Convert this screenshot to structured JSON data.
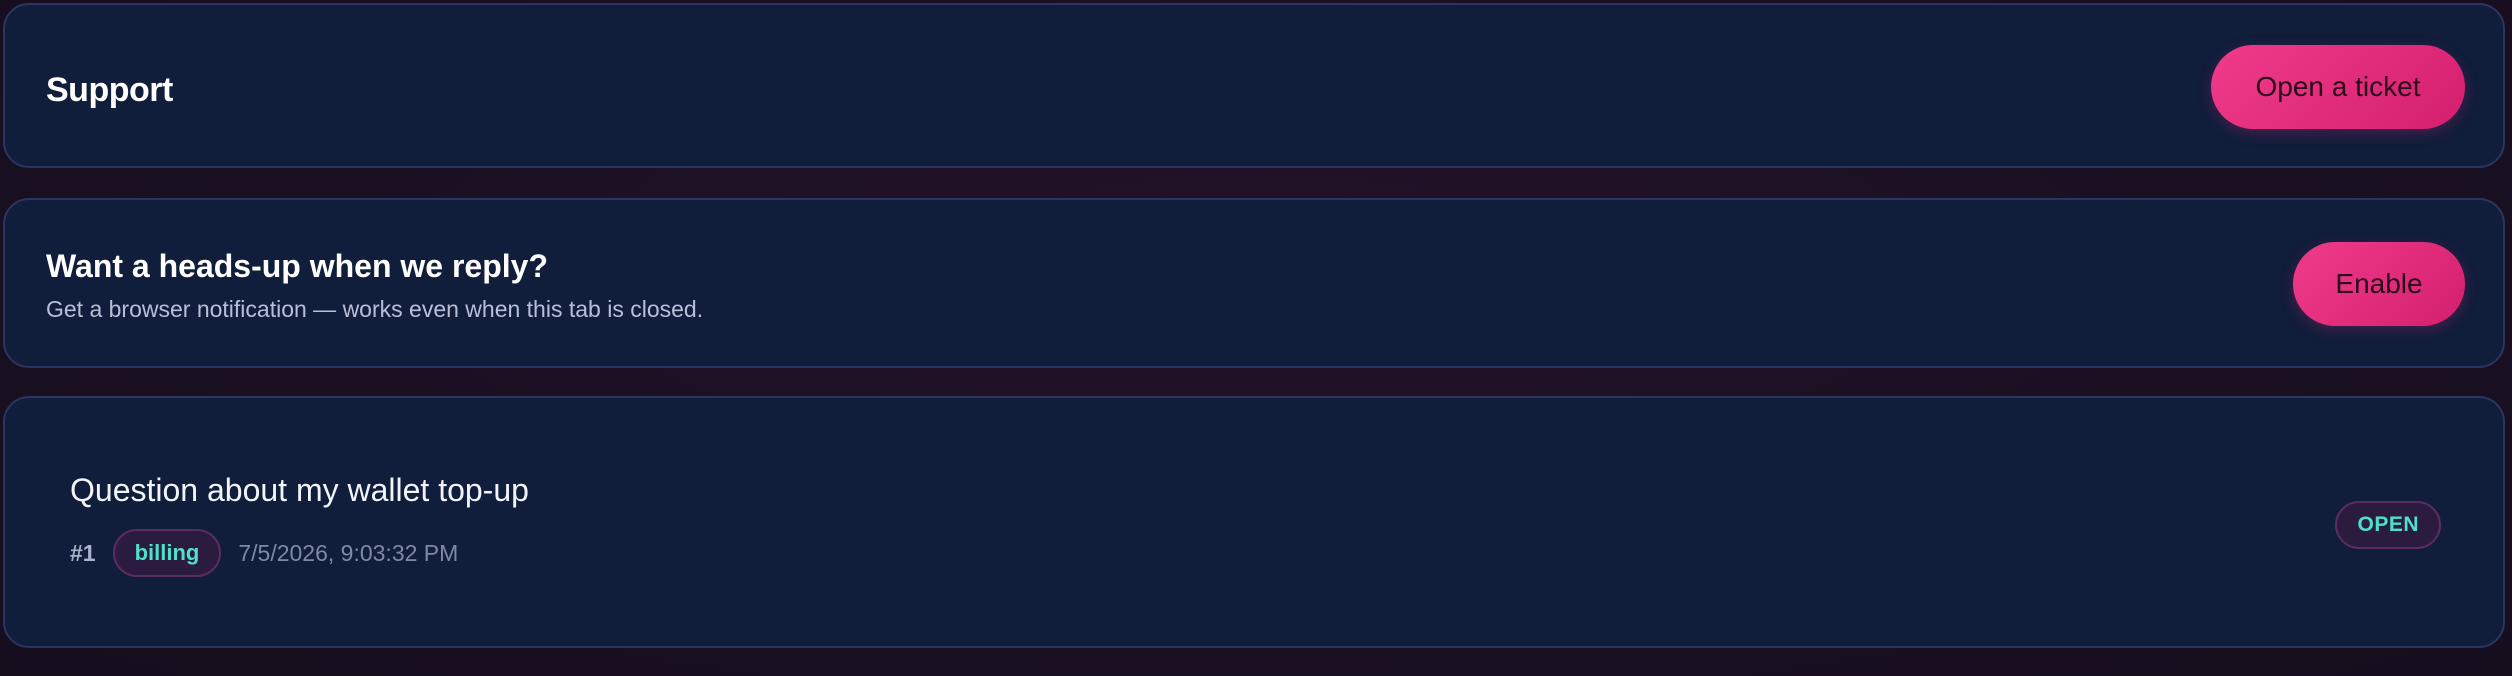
{
  "header": {
    "title": "Support",
    "open_ticket_label": "Open a ticket"
  },
  "notification": {
    "title": "Want a heads-up when we reply?",
    "subtitle": "Get a browser notification — works even when this tab is closed.",
    "enable_label": "Enable"
  },
  "tickets": [
    {
      "title": "Question about my wallet top-up",
      "number": "#1",
      "category": "billing",
      "timestamp": "7/5/2026, 9:03:32 PM",
      "status": "OPEN"
    }
  ],
  "colors": {
    "background": "#1a1022",
    "card": "#101d3b",
    "accent_pink": "#e62e7d",
    "tag_text": "#4fe0c8"
  }
}
